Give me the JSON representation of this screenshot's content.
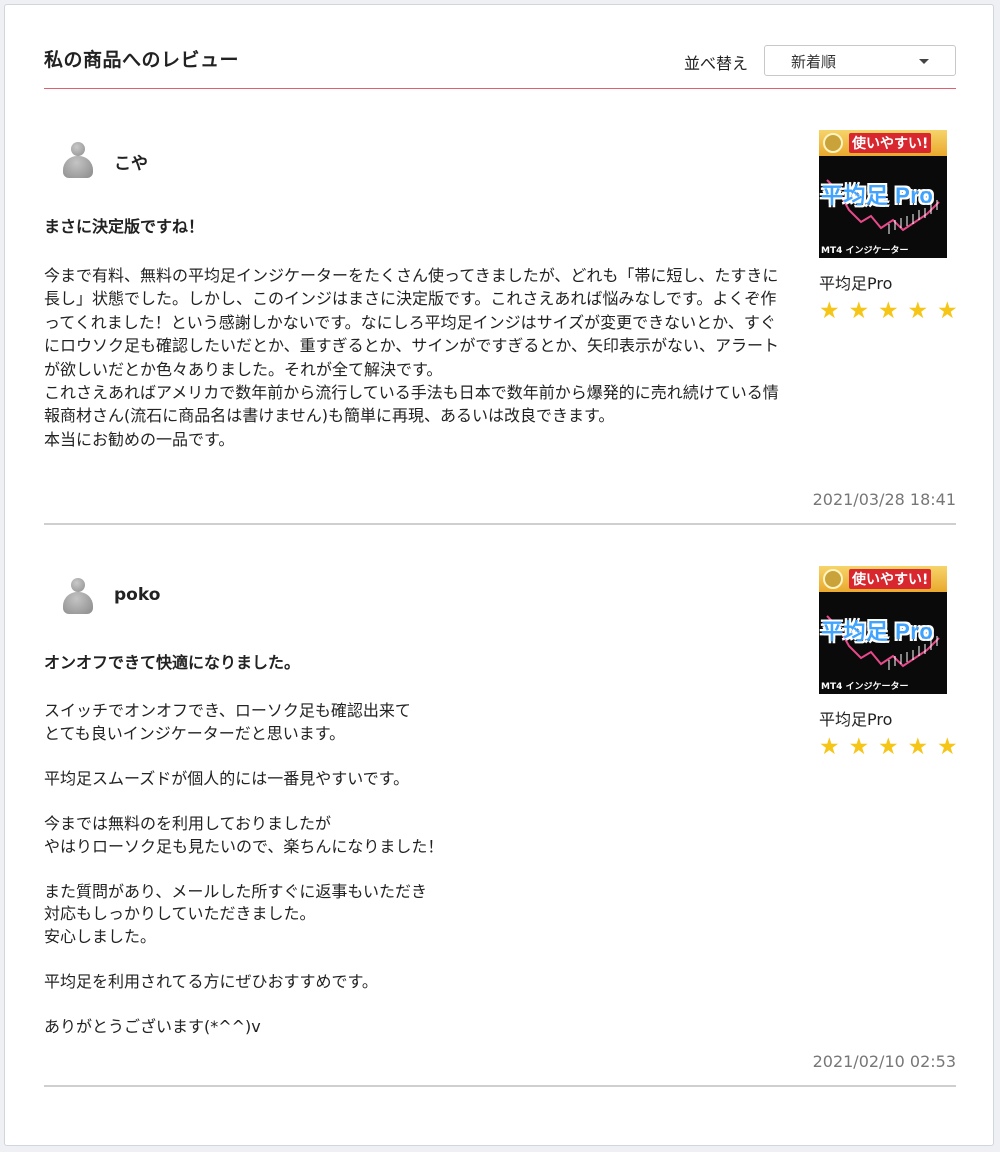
{
  "header": {
    "title": "私の商品へのレビュー",
    "sort_label": "並べ替え",
    "sort_value": "新着順"
  },
  "reviews": [
    {
      "user": "こや",
      "title": "まさに決定版ですね！",
      "body": "今まで有料、無料の平均足インジケーターをたくさん使ってきましたが、どれも「帯に短し、たすきに長し」状態でした。しかし、このインジはまさに決定版です。これさえあれば悩みなしです。よくぞ作ってくれました！という感謝しかないです。なにしろ平均足インジはサイズが変更できないとか、すぐにロウソク足も確認したいだとか、重すぎるとか、サインがですぎるとか、矢印表示がない、アラートが欲しいだとか色々ありました。それが全て解決です。\nこれさえあればアメリカで数年前から流行している手法も日本で数年前から爆発的に売れ続けている情報商材さん(流石に商品名は書けません)も簡単に再現、あるいは改良できます。\n本当にお勧めの一品です。",
      "product_name": "平均足Pro",
      "product_image_banner": "使いやすい!",
      "product_image_title": "平均足 Pro",
      "product_image_footer": "MT4 インジケーター",
      "rating": 5,
      "stars": [
        "★",
        "★",
        "★",
        "★",
        "★"
      ],
      "timestamp": "2021/03/28 18:41"
    },
    {
      "user": "poko",
      "title": "オンオフできて快適になりました。",
      "body": "スイッチでオンオフでき、ローソク足も確認出来て\nとても良いインジケーターだと思います。\n\n平均足スムーズドが個人的には一番見やすいです。\n\n今までは無料のを利用しておりましたが\nやはりローソク足も見たいので、楽ちんになりました！\n\nまた質問があり、メールした所すぐに返事もいただき\n対応もしっかりしていただきました。\n安心しました。\n\n平均足を利用されてる方にぜひおすすめです。\n\nありがとうございます(*^^)v",
      "product_name": "平均足Pro",
      "product_image_banner": "使いやすい!",
      "product_image_title": "平均足 Pro",
      "product_image_footer": "MT4 インジケーター",
      "rating": 5,
      "stars": [
        "★",
        "★",
        "★",
        "★",
        "★"
      ],
      "timestamp": "2021/02/10 02:53"
    }
  ],
  "colors": {
    "accent_line": "#e06070",
    "star": "#f5c518",
    "timestamp": "#777777"
  }
}
